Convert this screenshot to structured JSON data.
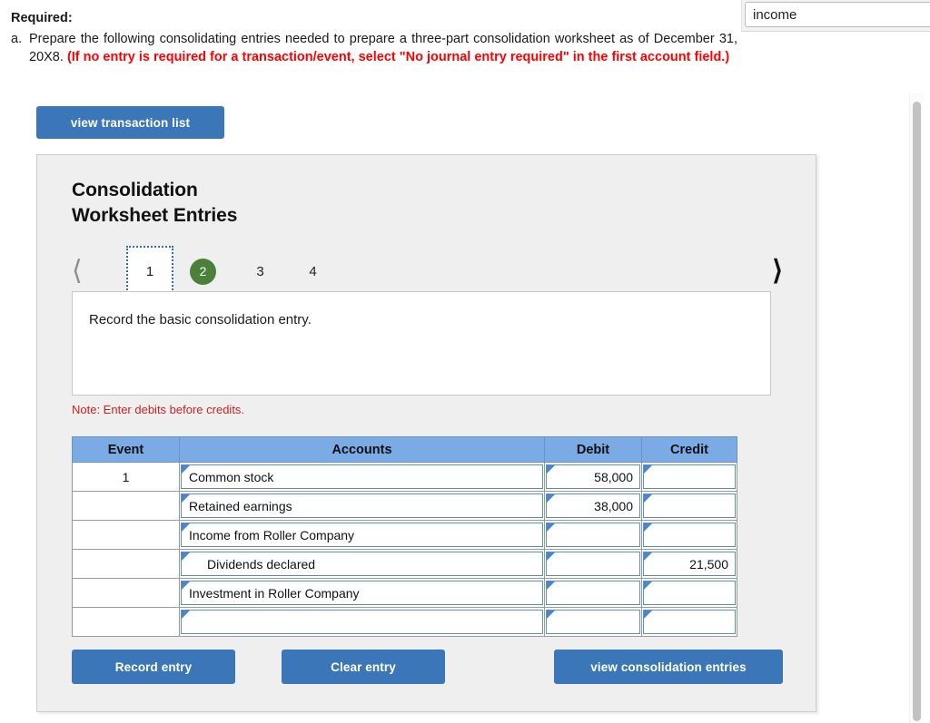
{
  "required": {
    "title": "Required:",
    "item_marker": "a.",
    "line1": "Prepare the following consolidating entries needed to prepare a three-part consolidation worksheet as of December 31, 20X8.",
    "line_red": "(If no entry is required for a transaction/event, select \"No journal entry required\" in the first account field.)"
  },
  "income_field": {
    "value": "income",
    "placeholder": ""
  },
  "toolbar": {
    "view_transaction_list": "view transaction list"
  },
  "card": {
    "title_line1": "Consolidation",
    "title_line2": "Worksheet Entries",
    "instruction": "Record the basic consolidation entry.",
    "note": "Note: Enter debits before credits."
  },
  "stepper": {
    "prev_icon": "chevron-left",
    "next_icon": "chevron-right",
    "steps": [
      {
        "label": "1",
        "state": "focused"
      },
      {
        "label": "2",
        "state": "active"
      },
      {
        "label": "3",
        "state": "normal"
      },
      {
        "label": "4",
        "state": "normal"
      }
    ]
  },
  "journal": {
    "headers": [
      "Event",
      "Accounts",
      "Debit",
      "Credit"
    ],
    "rows": [
      {
        "event": "1",
        "account": "Common stock",
        "indent": false,
        "debit": "58,000",
        "credit": ""
      },
      {
        "event": "",
        "account": "Retained earnings",
        "indent": false,
        "debit": "38,000",
        "credit": ""
      },
      {
        "event": "",
        "account": "Income from Roller Company",
        "indent": false,
        "debit": "",
        "credit": ""
      },
      {
        "event": "",
        "account": "Dividends declared",
        "indent": true,
        "debit": "",
        "credit": "21,500"
      },
      {
        "event": "",
        "account": "Investment in Roller Company",
        "indent": false,
        "debit": "",
        "credit": ""
      },
      {
        "event": "",
        "account": "",
        "indent": false,
        "debit": "",
        "credit": ""
      }
    ]
  },
  "actions": {
    "record_entry": "Record entry",
    "clear_entry": "Clear entry",
    "view_consolidation_entries": "view consolidation entries"
  },
  "colors": {
    "button_blue": "#3a76b8",
    "header_blue": "#7aabe5",
    "active_step_green": "#4a8039",
    "warning_red": "#ff0000",
    "note_red": "#cc2122",
    "card_bg": "#efefef"
  }
}
